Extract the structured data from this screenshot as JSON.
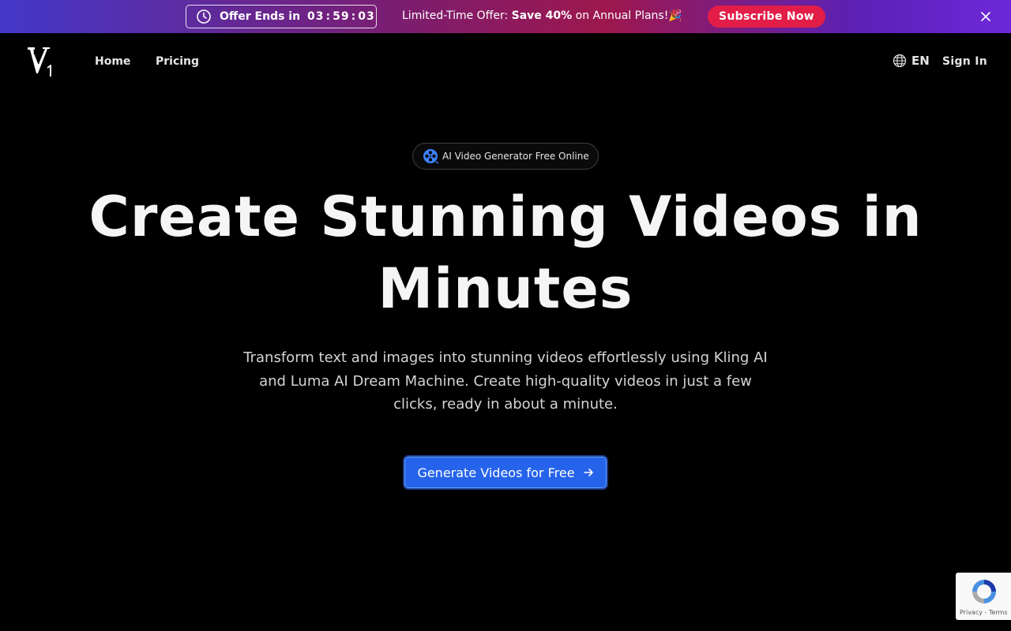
{
  "banner": {
    "offer_label": "Offer Ends in",
    "timer": {
      "hours": "03",
      "minutes": "59",
      "seconds": "03"
    },
    "promo_prefix": "Limited-Time Offer: ",
    "promo_bold": "Save 40%",
    "promo_suffix": " on Annual Plans!🎉",
    "subscribe_label": "Subscribe Now"
  },
  "header": {
    "nav": [
      {
        "label": "Home"
      },
      {
        "label": "Pricing"
      }
    ],
    "language": "EN",
    "sign_in_label": "Sign In"
  },
  "hero": {
    "badge_text": "AI Video Generator Free Online",
    "title_line1": "Create Stunning Videos in",
    "title_line2": "Minutes",
    "description": "Transform text and images into stunning videos effortlessly using Kling AI and Luma AI Dream Machine. Create high-quality videos in just a few clicks, ready in about a minute.",
    "cta_label": "Generate Videos for Free"
  },
  "recaptcha": {
    "privacy": "Privacy",
    "terms": "Terms"
  },
  "colors": {
    "accent": "#2563eb",
    "subscribe": "#e11d48",
    "background": "#000000"
  },
  "icons": {
    "clock": "clock-icon",
    "close": "close-icon",
    "globe": "globe-icon",
    "film_reel": "film-reel-icon",
    "arrow": "arrow-right-icon",
    "logo": "v1-logo"
  }
}
